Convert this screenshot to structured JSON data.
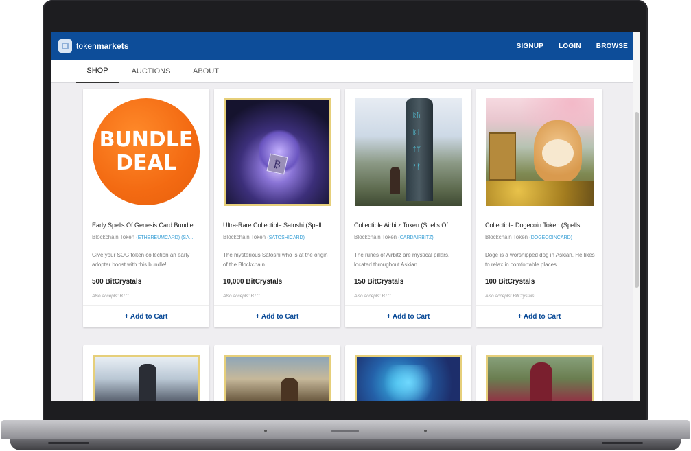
{
  "brand": {
    "prefix": "token",
    "suffix": "markets"
  },
  "topnav": {
    "links": [
      "SIGNUP",
      "LOGIN",
      "BROWSE"
    ]
  },
  "tabs": [
    "SHOP",
    "AUCTIONS",
    "ABOUT"
  ],
  "active_tab": "SHOP",
  "cart_label": "+ Add to Cart",
  "bundle_text": {
    "line1": "BUNDLE",
    "line2": "DEAL"
  },
  "products": [
    {
      "name": "Early Spells Of Genesis Card Bundle",
      "chain": "Blockchain Token",
      "token": "(ETHEREUMCARD) (SA...",
      "desc": "Give your SOG token collection an early adopter boost with this bundle!",
      "price": "500 BitCrystals",
      "also": "Also accepts: BTC",
      "image": "bundle-deal"
    },
    {
      "name": "Ultra-Rare Collectible Satoshi (Spell...",
      "chain": "Blockchain Token",
      "token": "(SATOSHICARD)",
      "desc": "The mysterious Satoshi who is at the origin of the Blockchain.",
      "price": "10,000 BitCrystals",
      "also": "Also accepts: BTC",
      "image": "satoshi-card"
    },
    {
      "name": "Collectible Airbitz Token (Spells Of ...",
      "chain": "Blockchain Token",
      "token": "(CARDAIRBITZ)",
      "desc": "The runes of Airbitz are mystical pillars, located throughout Askian.",
      "price": "150 BitCrystals",
      "also": "Also accepts: BTC",
      "image": "airbitz-pillar"
    },
    {
      "name": "Collectible Dogecoin Token (Spells ...",
      "chain": "Blockchain Token",
      "token": "(DOGECOINCARD)",
      "desc": "Doge is a worshipped dog in Askian. He likes to relax in comfortable places.",
      "price": "100 BitCrystals",
      "also": "Also accepts: BitCrystals",
      "image": "doge-card"
    }
  ]
}
